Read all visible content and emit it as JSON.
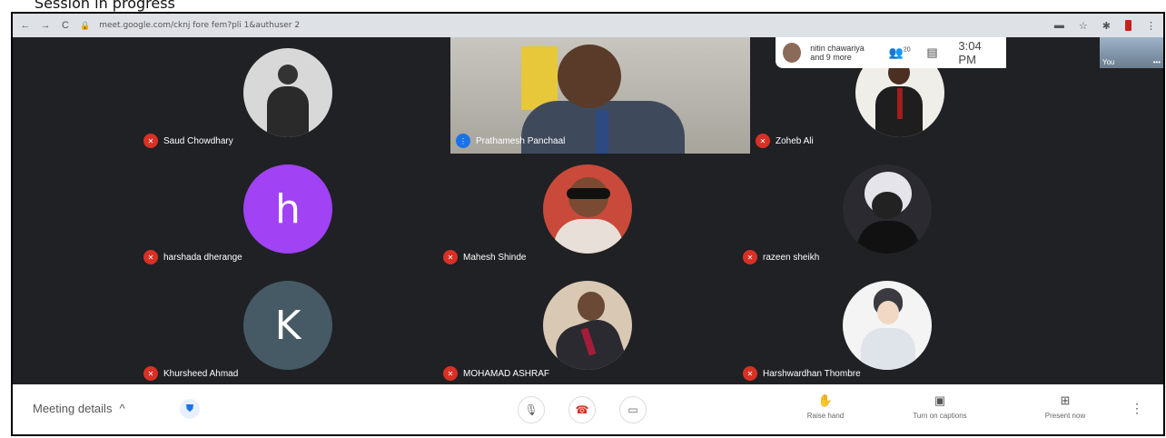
{
  "caption": "Session in progress",
  "browser": {
    "back": "←",
    "forward": "→",
    "reload": "C",
    "url": "meet.google.com/cknj fore fem?pli 1&authuser 2",
    "toolbar_icons": [
      "☆",
      "✱",
      "⋮"
    ]
  },
  "top_panel": {
    "participants_text_line1": "nitin chawariya",
    "participants_text_line2": "and 9 more",
    "people_count": "20",
    "time": "3:04 PM",
    "self_label": "You"
  },
  "presenter": {
    "name": "Prathamesh Panchaal"
  },
  "participants": [
    {
      "name": "Saud Chowdhary",
      "avatar": "photo",
      "photo_color": "#d8d8d8"
    },
    {
      "name": "Zoheb Ali",
      "avatar": "photo",
      "photo_color": "#6b2a2a"
    },
    {
      "name": "harshada dherange",
      "avatar": "letter",
      "letter": "h",
      "color": "#a142f4"
    },
    {
      "name": "Mahesh Shinde",
      "avatar": "photo",
      "photo_color": "#c94a3a"
    },
    {
      "name": "razeen sheikh",
      "avatar": "photo",
      "photo_color": "#4a4a52"
    },
    {
      "name": "Khursheed Ahmad",
      "avatar": "letter",
      "letter": "K",
      "color": "#455a64"
    },
    {
      "name": "MOHAMAD ASHRAF",
      "avatar": "photo",
      "photo_color": "#b89a80"
    },
    {
      "name": "Harshwardhan Thombre",
      "avatar": "photo",
      "photo_color": "#e8e8e8"
    }
  ],
  "bottom": {
    "meeting_details": "Meeting details",
    "chevron": "^",
    "raise_hand": "Raise hand",
    "captions": "Turn on captions",
    "present": "Present now"
  }
}
